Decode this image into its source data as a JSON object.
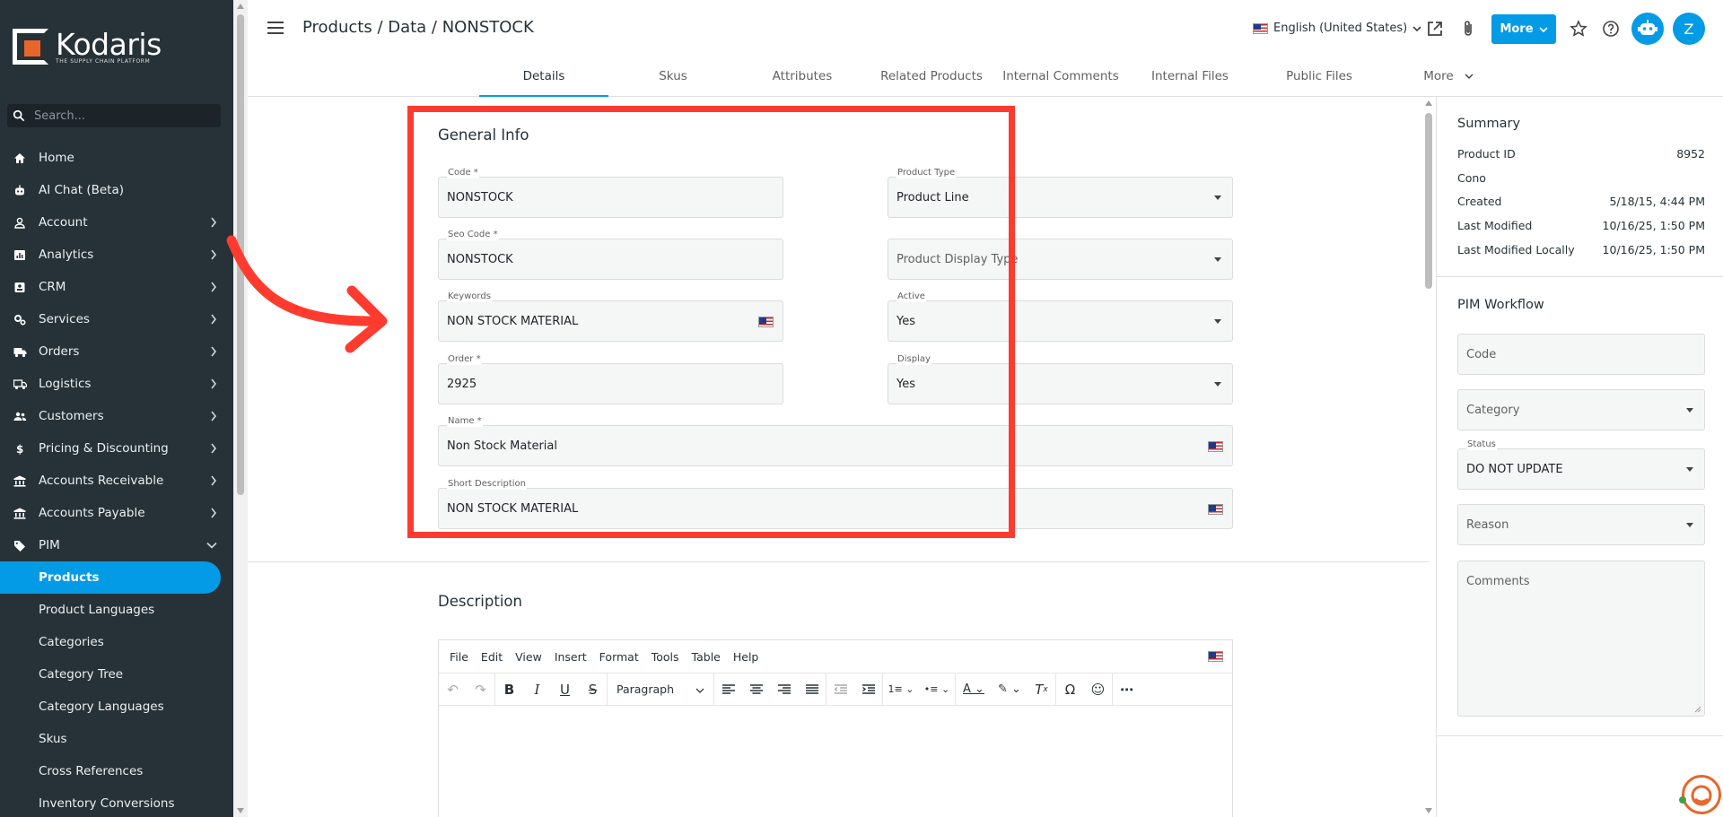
{
  "app": {
    "brand": "Kodaris",
    "tagline": "THE SUPPLY CHAIN PLATFORM"
  },
  "sidebar": {
    "search_placeholder": "Search...",
    "items": [
      {
        "label": "Home",
        "icon": "home-icon",
        "has_chevron": false
      },
      {
        "label": "AI Chat (Beta)",
        "icon": "robot-icon",
        "has_chevron": false
      },
      {
        "label": "Account",
        "icon": "person-icon",
        "has_chevron": true
      },
      {
        "label": "Analytics",
        "icon": "analytics-icon",
        "has_chevron": true
      },
      {
        "label": "CRM",
        "icon": "contact-card-icon",
        "has_chevron": true
      },
      {
        "label": "Services",
        "icon": "services-icon",
        "has_chevron": true
      },
      {
        "label": "Orders",
        "icon": "truck-icon",
        "has_chevron": true
      },
      {
        "label": "Logistics",
        "icon": "logistics-truck-icon",
        "has_chevron": true
      },
      {
        "label": "Customers",
        "icon": "people-icon",
        "has_chevron": true
      },
      {
        "label": "Pricing & Discounting",
        "icon": "dollar-icon",
        "has_chevron": true
      },
      {
        "label": "Accounts Receivable",
        "icon": "bank-icon",
        "has_chevron": true
      },
      {
        "label": "Accounts Payable",
        "icon": "bank-icon",
        "has_chevron": true
      },
      {
        "label": "PIM",
        "icon": "tag-icon",
        "has_chevron": true,
        "expanded": true
      }
    ],
    "sub_items": [
      {
        "label": "Products",
        "active": true
      },
      {
        "label": "Product Languages"
      },
      {
        "label": "Categories"
      },
      {
        "label": "Category Tree"
      },
      {
        "label": "Category Languages"
      },
      {
        "label": "Skus"
      },
      {
        "label": "Cross References"
      },
      {
        "label": "Inventory Conversions"
      }
    ]
  },
  "header": {
    "breadcrumb": "Products / Data / NONSTOCK",
    "language": "English (United States)",
    "more_button": "More",
    "avatar_initial": "Z"
  },
  "tabs": [
    {
      "label": "Details",
      "active": true
    },
    {
      "label": "Skus"
    },
    {
      "label": "Attributes"
    },
    {
      "label": "Related Products"
    },
    {
      "label": "Internal Comments"
    },
    {
      "label": "Internal Files"
    },
    {
      "label": "Public Files"
    },
    {
      "label": "More",
      "dropdown": true
    }
  ],
  "general_info": {
    "title": "General Info",
    "code": {
      "label": "Code *",
      "value": "NONSTOCK"
    },
    "product_type": {
      "label": "Product Type",
      "value": "Product Line"
    },
    "seo_code": {
      "label": "Seo Code *",
      "value": "NONSTOCK"
    },
    "product_display_type": {
      "placeholder": "Product Display Type"
    },
    "keywords": {
      "label": "Keywords",
      "value": "NON STOCK MATERIAL"
    },
    "active": {
      "label": "Active",
      "value": "Yes"
    },
    "order": {
      "label": "Order *",
      "value": "2925"
    },
    "display": {
      "label": "Display",
      "value": "Yes"
    },
    "name": {
      "label": "Name *",
      "value": "Non Stock Material"
    },
    "short_description": {
      "label": "Short Description",
      "value": "NON STOCK MATERIAL"
    }
  },
  "description": {
    "title": "Description",
    "menu": [
      "File",
      "Edit",
      "View",
      "Insert",
      "Format",
      "Tools",
      "Table",
      "Help"
    ],
    "block_format": "Paragraph"
  },
  "summary": {
    "title": "Summary",
    "rows": [
      {
        "label": "Product ID",
        "value": "8952"
      },
      {
        "label": "Cono",
        "value": ""
      },
      {
        "label": "Created",
        "value": "5/18/15, 4:44 PM"
      },
      {
        "label": "Last Modified",
        "value": "10/16/25, 1:50 PM"
      },
      {
        "label": "Last Modified Locally",
        "value": "10/16/25, 1:50 PM"
      }
    ]
  },
  "pim_workflow": {
    "title": "PIM Workflow",
    "code_placeholder": "Code",
    "category_placeholder": "Category",
    "status_label": "Status",
    "status_value": "DO NOT UPDATE",
    "reason_placeholder": "Reason",
    "comments_placeholder": "Comments"
  },
  "colors": {
    "accent": "#039be5",
    "sidebar_bg": "#263238",
    "highlight": "#ff3b30",
    "brand_orange": "#e8652b"
  }
}
